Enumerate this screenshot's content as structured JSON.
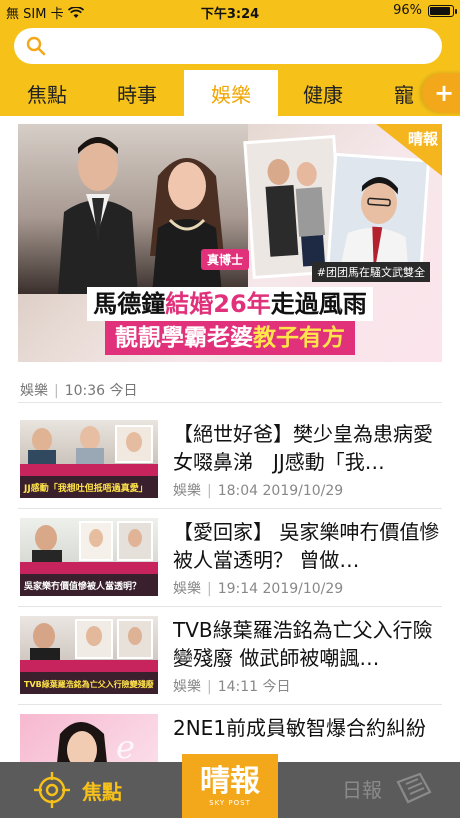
{
  "status_bar": {
    "carrier": "無 SIM 卡",
    "time": "下午3:24",
    "battery": "96%",
    "battery_level": 0.96
  },
  "search": {
    "placeholder": ""
  },
  "tabs": [
    {
      "label": "焦點",
      "active": false
    },
    {
      "label": "時事",
      "active": false
    },
    {
      "label": "娛樂",
      "active": true
    },
    {
      "label": "健康",
      "active": false
    },
    {
      "label": "寵",
      "active": false
    }
  ],
  "add_tab_symbol": "+",
  "hero": {
    "badge": "晴報",
    "tag_title": "真博士",
    "tag_caption": "#团团馬在騷文武雙全",
    "headline_part1": "馬德鐘",
    "headline_highlight": "結婚26年",
    "headline_part2": "走過風雨",
    "subline_part1": "靚靚學霸老婆",
    "subline_highlight": "教子有方",
    "category": "娛樂",
    "time": "10:36 今日"
  },
  "articles": [
    {
      "title": "【絕世好爸】樊少皇為患病愛女啜鼻涕　JJ感動「我…",
      "category": "娛樂",
      "time": "18:04 2019/10/29",
      "thumb_caption": "JJ感動「我想吐但抵唔過真愛」"
    },
    {
      "title": "【愛回家】 吳家樂呻冇價值慘被人當透明？ 曾做…",
      "category": "娛樂",
      "time": "19:14 2019/10/29",
      "thumb_caption": "吳家樂冇價值慘被人當透明？"
    },
    {
      "title": "TVB綠葉羅浩銘為亡父入行險變殘廢 做武師被嘲諷…",
      "category": "娛樂",
      "time": "14:11 今日",
      "thumb_caption": "TVB綠葉羅浩銘為亡父入行險變殘廢"
    },
    {
      "title": "2NE1前成員敏智爆合約糾紛",
      "category": "",
      "time": "",
      "thumb_caption": ""
    }
  ],
  "bottom_nav": {
    "left_label": "焦點",
    "center_label": "晴報",
    "center_sub": "SKY POST",
    "right_label": "日報"
  },
  "colors": {
    "brand_yellow": "#f6c21a",
    "brand_orange": "#f3a81c",
    "accent_pink": "#e0317a",
    "nav_gray": "#5b5b5b"
  }
}
